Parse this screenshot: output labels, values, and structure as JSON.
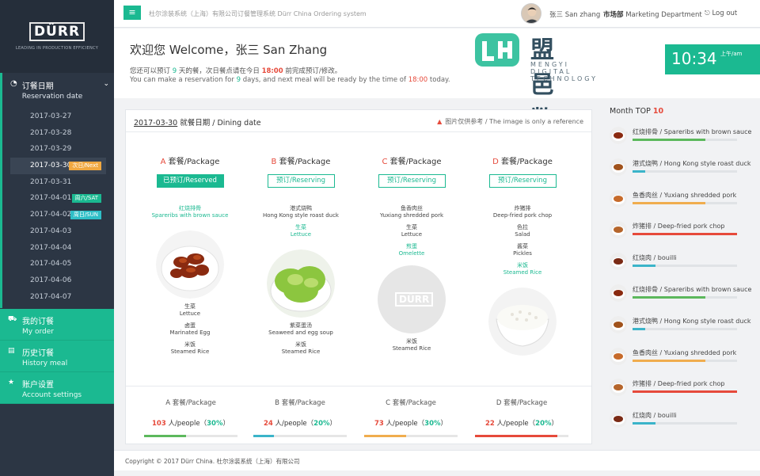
{
  "brand": {
    "logo_text": "DÜRR",
    "tagline": "LEADING IN PRODUCTION EFFICIENCY"
  },
  "topbar": {
    "menu_icon": "menu-icon",
    "system_title": "杜尔涂装系统（上海）有限公司订餐管理系统 Dürr China Ordering system",
    "user_name": "张三 San zhang",
    "dept_cn": "市场部",
    "dept_en": "Marketing Department",
    "logout": "Log out"
  },
  "sidebar": {
    "reservation": {
      "title": "订餐日期",
      "subtitle": "Reservation date"
    },
    "dates": [
      {
        "label": "2017-03-27",
        "badge": ""
      },
      {
        "label": "2017-03-28",
        "badge": ""
      },
      {
        "label": "2017-03-29",
        "badge": ""
      },
      {
        "label": "2017-03-30",
        "badge": "次日/Next"
      },
      {
        "label": "2017-03-31",
        "badge": ""
      },
      {
        "label": "2017-04-01",
        "badge": "周六/SAT"
      },
      {
        "label": "2017-04-02",
        "badge": "周日/SUN"
      },
      {
        "label": "2017-04-03",
        "badge": ""
      },
      {
        "label": "2017-04-04",
        "badge": ""
      },
      {
        "label": "2017-04-05",
        "badge": ""
      },
      {
        "label": "2017-04-06",
        "badge": ""
      },
      {
        "label": "2017-04-07",
        "badge": ""
      }
    ],
    "menu": [
      {
        "title": "我的订餐",
        "subtitle": "My order",
        "icon": "cart-icon"
      },
      {
        "title": "历史订餐",
        "subtitle": "History meal",
        "icon": "history-icon"
      },
      {
        "title": "账户设置",
        "subtitle": "Account settings",
        "icon": "star-icon"
      }
    ]
  },
  "welcome": {
    "title": "欢迎您 Welcome，张三 San Zhang",
    "line1_a": "您还可以预订",
    "days": "9",
    "line1_b": "天的餐，次日餐点请在今日",
    "time": "18:00",
    "line1_c": "前完成预订/修改。",
    "line2_a": "You can make a reservation for",
    "line2_b": "days, and next meal will be ready by the time of",
    "line2_c": "today.",
    "watermark_cn": "盟邑数字科技",
    "watermark_en": "MENGYI DIGITAL TECHNOLOGY",
    "clock": "10:34",
    "clock_ampm": "上午/am"
  },
  "dining": {
    "date": "2017-03-30",
    "label": "就餐日期 / Dining date",
    "note": "图片仅供参考 / The image is only a reference",
    "packages": [
      {
        "letter": "A",
        "label": "套餐/Package",
        "button": "已预订/Reserved",
        "reserved": true,
        "dishes_top": [
          {
            "cn": "红烧排骨",
            "en": "Spareribs with brown sauce",
            "hl": true
          }
        ],
        "dishes_bottom": [
          {
            "cn": "生菜",
            "en": "Lettuce"
          },
          {
            "cn": "卤蛋",
            "en": "Marinated Egg"
          },
          {
            "cn": "米饭",
            "en": "Steamed Rice"
          }
        ]
      },
      {
        "letter": "B",
        "label": "套餐/Package",
        "button": "预订/Reserving",
        "reserved": false,
        "dishes_top": [
          {
            "cn": "港式烧鸭",
            "en": "Hong Kong style roast duck",
            "hl": false
          },
          {
            "cn": "生菜",
            "en": "Lettuce",
            "hl": true
          }
        ],
        "dishes_bottom": [
          {
            "cn": "紫菜蛋汤",
            "en": "Seaweed and egg soup"
          },
          {
            "cn": "米饭",
            "en": "Steamed Rice"
          }
        ]
      },
      {
        "letter": "C",
        "label": "套餐/Package",
        "button": "预订/Reserving",
        "reserved": false,
        "dishes_top": [
          {
            "cn": "鱼香肉丝",
            "en": "Yuxiang shredded pork",
            "hl": false
          },
          {
            "cn": "生菜",
            "en": "Lettuce",
            "hl": false
          },
          {
            "cn": "煎蛋",
            "en": "Omelette",
            "hl": true
          }
        ],
        "dishes_bottom": [
          {
            "cn": "米饭",
            "en": "Steamed Rice"
          }
        ]
      },
      {
        "letter": "D",
        "label": "套餐/Package",
        "button": "预订/Reserving",
        "reserved": false,
        "dishes_top": [
          {
            "cn": "炸猪排",
            "en": "Deep-fried pork chop",
            "hl": false
          },
          {
            "cn": "色拉",
            "en": "Salad",
            "hl": false
          },
          {
            "cn": "酱菜",
            "en": "Pickles",
            "hl": false
          },
          {
            "cn": "米饭",
            "en": "Steamed Rice",
            "hl": true
          }
        ],
        "dishes_bottom": []
      }
    ],
    "placeholder_logo": "DÜRR",
    "stats": [
      {
        "label": "A 套餐/Package",
        "count": "103",
        "unit": "人/people（",
        "pct": "30%",
        "close": "）",
        "fill": 0.45,
        "color": "#5cb85c"
      },
      {
        "label": "B 套餐/Package",
        "count": "24",
        "unit": "人/people（",
        "pct": "20%",
        "close": "）",
        "fill": 0.22,
        "color": "#3bb4c9"
      },
      {
        "label": "C 套餐/Package",
        "count": "73",
        "unit": "人/people（",
        "pct": "30%",
        "close": "）",
        "fill": 0.45,
        "color": "#f0ad4e"
      },
      {
        "label": "D 套餐/Package",
        "count": "22",
        "unit": "人/people（",
        "pct": "20%",
        "close": "）",
        "fill": 0.88,
        "color": "#e64a3b"
      }
    ]
  },
  "top10": {
    "title": "Month TOP",
    "num": "10",
    "items": [
      {
        "name": "红烧排骨 / Spareribs with brown sauce",
        "fill": 0.7,
        "color": "#5cb85c"
      },
      {
        "name": "港式烧鸭 / Hong Kong style roast duck",
        "fill": 0.12,
        "color": "#3bb4c9"
      },
      {
        "name": "鱼香肉丝 / Yuxiang shredded pork",
        "fill": 0.7,
        "color": "#f0ad4e"
      },
      {
        "name": "炸猪排 / Deep-fried pork chop",
        "fill": 1.0,
        "color": "#e64a3b"
      },
      {
        "name": "红烧肉 / bouilli",
        "fill": 0.22,
        "color": "#3bb4c9"
      },
      {
        "name": "红烧排骨 / Spareribs with brown sauce",
        "fill": 0.7,
        "color": "#5cb85c"
      },
      {
        "name": "港式烧鸭 / Hong Kong style roast duck",
        "fill": 0.12,
        "color": "#3bb4c9"
      },
      {
        "name": "鱼香肉丝 / Yuxiang shredded pork",
        "fill": 0.7,
        "color": "#f0ad4e"
      },
      {
        "name": "炸猪排 / Deep-fried pork chop",
        "fill": 1.0,
        "color": "#e64a3b"
      },
      {
        "name": "红烧肉 / bouilli",
        "fill": 0.22,
        "color": "#3bb4c9"
      }
    ]
  },
  "footer": {
    "text": "Copyright © 2017 Dürr China. 杜尔涂装系统（上海）有限公司"
  },
  "colors": {
    "accent": "#1bb991",
    "alert": "#e64a3b",
    "sidebar": "#2c3644"
  }
}
